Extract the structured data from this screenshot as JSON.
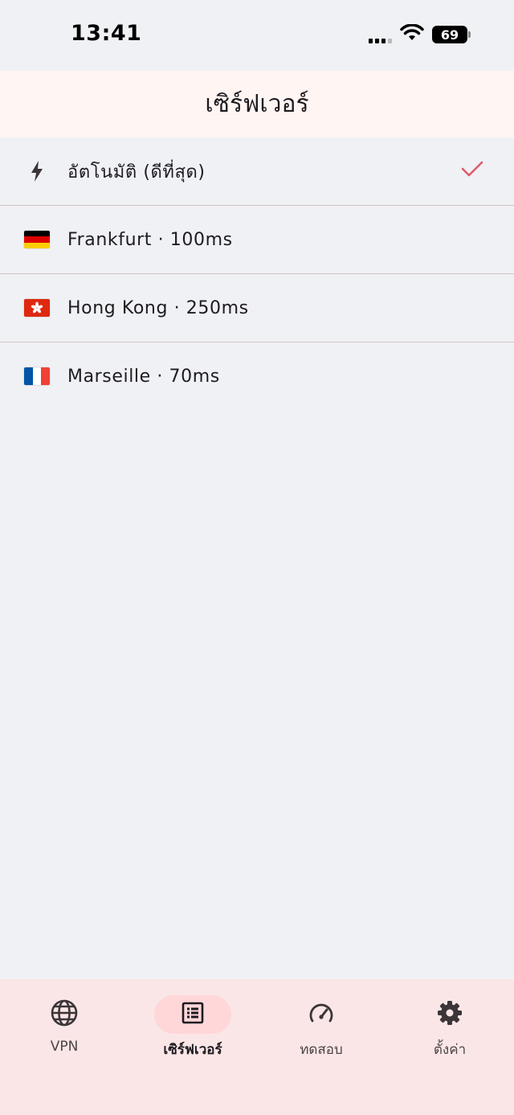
{
  "status_bar": {
    "time": "13:41",
    "battery": "69"
  },
  "header": {
    "title": "เซิร์ฟเวอร์"
  },
  "servers": [
    {
      "label": "อัตโนมัติ (ดีที่สุด)",
      "icon": "lightning-bolt-icon",
      "selected": true
    },
    {
      "label": "Frankfurt · 100ms",
      "icon": "germany-flag-icon",
      "selected": false
    },
    {
      "label": "Hong Kong · 250ms",
      "icon": "hong-kong-flag-icon",
      "selected": false
    },
    {
      "label": "Marseille · 70ms",
      "icon": "france-flag-icon",
      "selected": false
    }
  ],
  "bottom_nav": {
    "items": [
      {
        "label": "VPN",
        "icon": "globe-icon",
        "active": false
      },
      {
        "label": "เซิร์ฟเวอร์",
        "icon": "list-icon",
        "active": true
      },
      {
        "label": "ทดสอบ",
        "icon": "speedometer-icon",
        "active": false
      },
      {
        "label": "ตั้งค่า",
        "icon": "gear-icon",
        "active": false
      }
    ]
  },
  "colors": {
    "accent": "#e05a6d",
    "header_bg": "#fff5f3",
    "nav_bg": "#fae6e6",
    "active_pill": "#ffd7d9",
    "page_bg": "#f0f1f4"
  }
}
